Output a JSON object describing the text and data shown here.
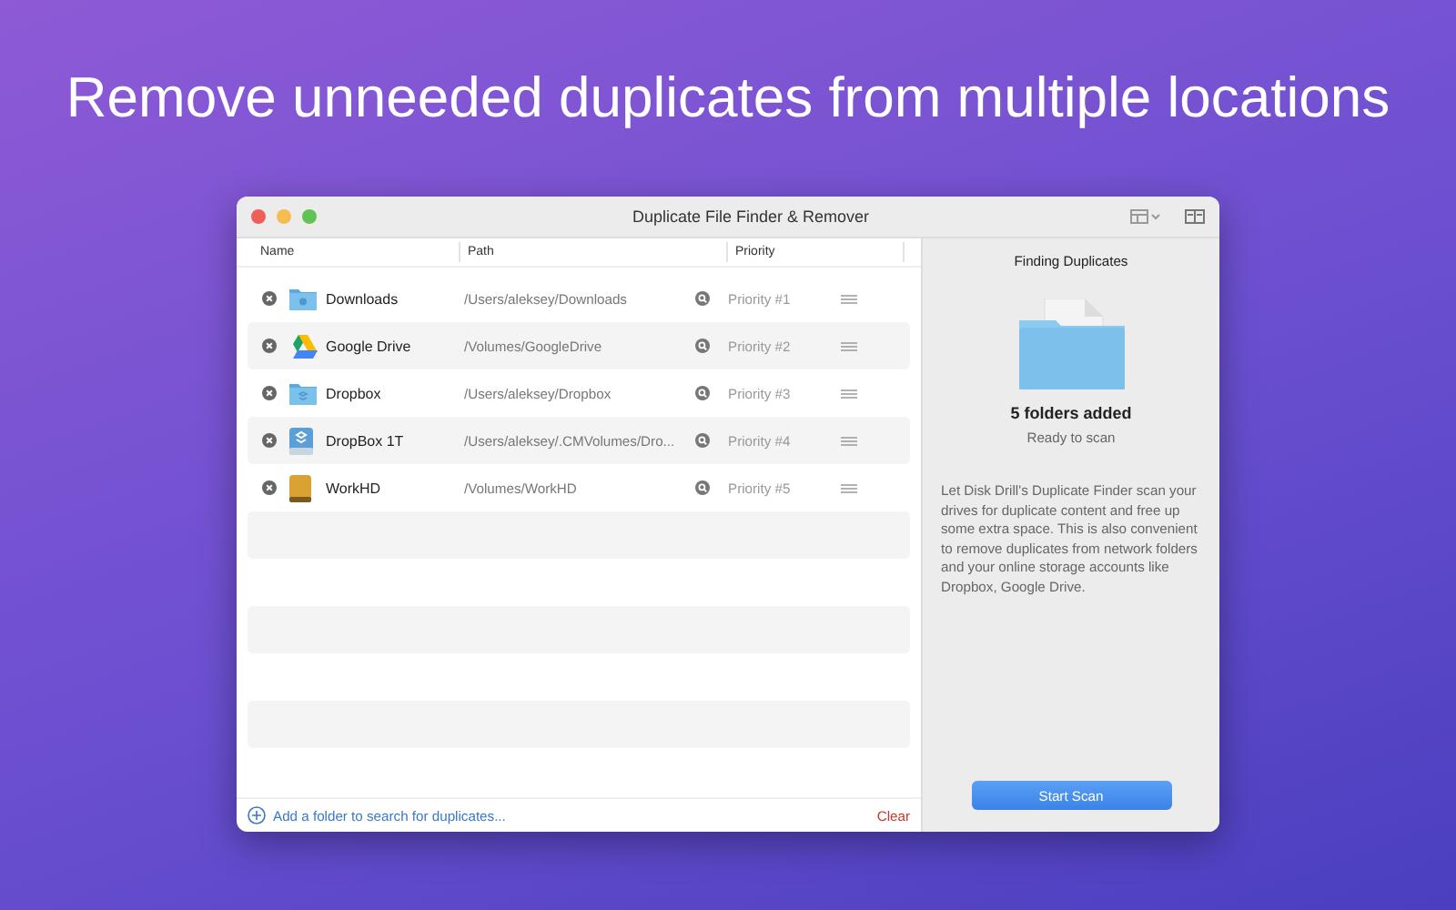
{
  "headline": "Remove unneeded duplicates from multiple locations",
  "window": {
    "title": "Duplicate File Finder & Remover"
  },
  "table": {
    "columns": [
      "Name",
      "Path",
      "Priority"
    ],
    "rows": [
      {
        "kind": "folder",
        "name": "Downloads",
        "path": "/Users/aleksey/Downloads",
        "priority": "Priority #1"
      },
      {
        "kind": "gdrive",
        "name": "Google Drive",
        "path": "/Volumes/GoogleDrive",
        "priority": "Priority #2"
      },
      {
        "kind": "dropbox-folder",
        "name": "Dropbox",
        "path": "/Users/aleksey/Dropbox",
        "priority": "Priority #3"
      },
      {
        "kind": "dropbox-drive",
        "name": "DropBox 1T",
        "path": "/Users/aleksey/.CMVolumes/Dro...",
        "priority": "Priority #4"
      },
      {
        "kind": "hdd",
        "name": "WorkHD",
        "path": "/Volumes/WorkHD",
        "priority": "Priority #5"
      }
    ]
  },
  "footer": {
    "add_link": "Add a folder to search for duplicates...",
    "clear": "Clear"
  },
  "side": {
    "title": "Finding Duplicates",
    "status": "5 folders added",
    "substatus": "Ready to scan",
    "description": "Let Disk Drill's Duplicate Finder scan your drives for duplicate content and free up some extra space. This is also convenient to remove duplicates from network folders and your online storage accounts like Dropbox, Google Drive.",
    "button": "Start Scan"
  }
}
